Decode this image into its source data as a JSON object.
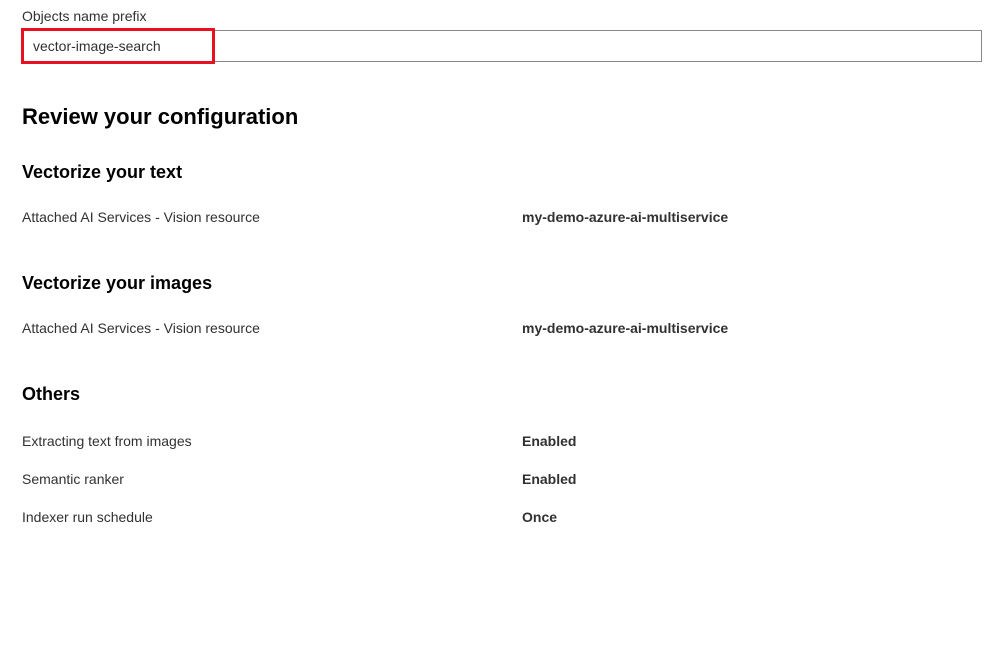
{
  "prefix_field": {
    "label": "Objects name prefix",
    "value": "vector-image-search"
  },
  "review_heading": "Review your configuration",
  "sections": {
    "vectorize_text": {
      "heading": "Vectorize your text",
      "rows": [
        {
          "label": "Attached AI Services - Vision resource",
          "value": "my-demo-azure-ai-multiservice"
        }
      ]
    },
    "vectorize_images": {
      "heading": "Vectorize your images",
      "rows": [
        {
          "label": "Attached AI Services - Vision resource",
          "value": "my-demo-azure-ai-multiservice"
        }
      ]
    },
    "others": {
      "heading": "Others",
      "rows": [
        {
          "label": "Extracting text from images",
          "value": "Enabled"
        },
        {
          "label": "Semantic ranker",
          "value": "Enabled"
        },
        {
          "label": "Indexer run schedule",
          "value": "Once"
        }
      ]
    }
  }
}
